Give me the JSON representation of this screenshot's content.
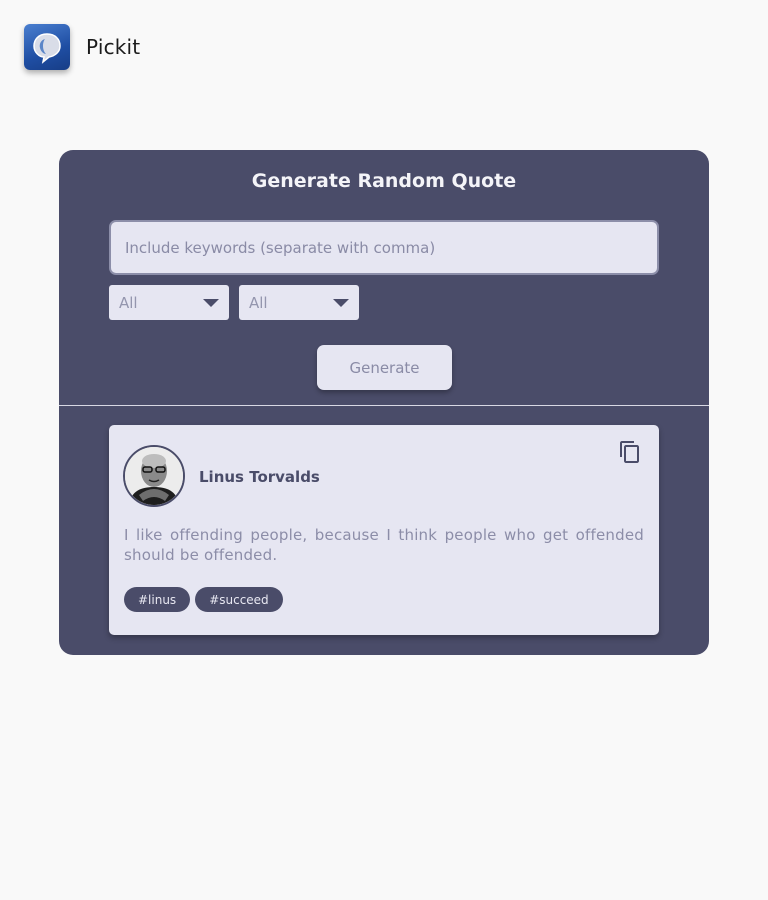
{
  "app": {
    "name": "Pickit",
    "logo_icon": "speech-bubble-icon"
  },
  "panel": {
    "title": "Generate Random Quote",
    "keyword_input": {
      "placeholder": "Include keywords (separate with comma)",
      "value": ""
    },
    "dropdowns": [
      {
        "value": "All"
      },
      {
        "value": "All"
      }
    ],
    "generate_label": "Generate"
  },
  "quote": {
    "author": "Linus Torvalds",
    "text": "I like offending people, because I think people who get offended should be offended.",
    "tags": [
      "#linus",
      "#succeed"
    ],
    "copy_icon": "copy-icon"
  },
  "colors": {
    "page_background": "#f9f9f9",
    "panel_background": "#4a4c69",
    "card_background": "#e6e6f2",
    "muted_text": "#8a8ba6",
    "logo_blue": "#1f4ea3"
  }
}
